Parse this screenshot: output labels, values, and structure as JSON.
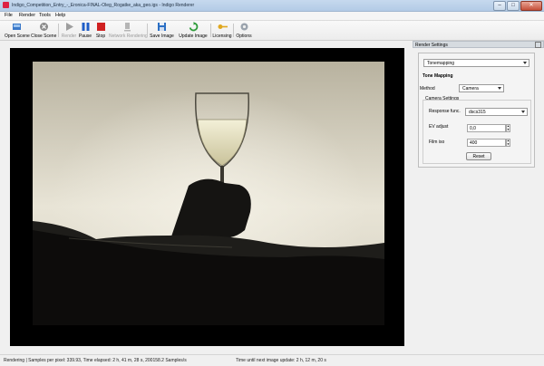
{
  "window": {
    "title": "Indigo_Competition_Entry_-_Eronica-FINAL-Oleg_Rogatke_aka_geo.igs - Indigo Renderer",
    "buttons": {
      "minimize": "–",
      "maximize": "□",
      "close": "✕"
    }
  },
  "menu": [
    "File",
    "Render",
    "Tools",
    "Help"
  ],
  "toolbar": {
    "open_scene": "Open Scene",
    "close_scene": "Close Scene",
    "render": "Render",
    "pause": "Pause",
    "stop": "Stop",
    "network_rendering": "Network Rendering",
    "save_image": "Save Image",
    "update_image": "Update Image",
    "licensing": "Licensing",
    "options": "Options"
  },
  "panel": {
    "title": "Render Settings",
    "section_select": "Tonemapping",
    "section_title": "Tone Mapping",
    "method_label": "Method",
    "method_value": "Camera",
    "camera_settings_label": "Camera Settings",
    "response_label": "Response func.",
    "response_value": "dscs315",
    "ev_label": "EV adjust",
    "ev_value": "0,0",
    "iso_label": "Film iso",
    "iso_value": "400",
    "reset": "Reset"
  },
  "status": {
    "left": "Rendering | Samples per pixel: 339.93, Time elapsed: 2 h, 41 m, 28 s, 200158.2 Samples/s",
    "right": "Time until next image update: 2 h, 12 m, 20 s"
  },
  "colors": {
    "accent_blue": "#2b6fc4",
    "pause_blue": "#1f5ec8",
    "stop_red": "#d02020",
    "update_green": "#2e9c3a",
    "licensing_gold": "#e0a820"
  },
  "icons": [
    "open-scene-icon",
    "close-scene-icon",
    "render-icon",
    "pause-icon",
    "stop-icon",
    "network-icon",
    "save-icon",
    "update-icon",
    "key-icon",
    "gear-icon"
  ]
}
